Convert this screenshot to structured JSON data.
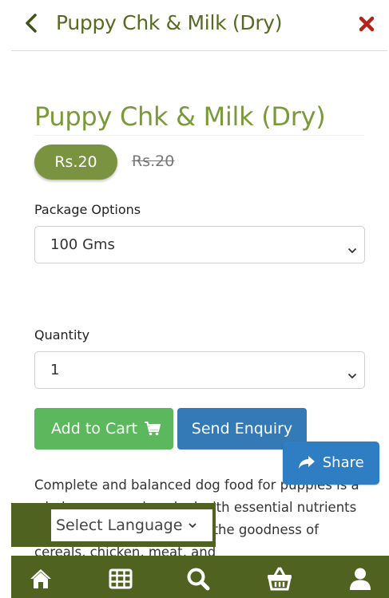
{
  "header": {
    "title": "Puppy Chk & Milk (Dry)"
  },
  "product": {
    "title": "Puppy Chk & Milk (Dry)",
    "price": "Rs.20",
    "old_price": "Rs.20",
    "package_label": "Package Options",
    "package_value": "100 Gms",
    "quantity_label": "Quantity",
    "quantity_value": "1",
    "description": "Complete and balanced dog food for puppies is a wholesome meal packed with essential nutrients of your pet. Pedigree, with the goodness of cereals, chicken, meat, and"
  },
  "actions": {
    "add_to_cart": "Add to Cart",
    "send_enquiry": "Send Enquiry",
    "share": "Share"
  },
  "language": {
    "selected": "Select Language"
  },
  "colors": {
    "brand_olive": "#4f6220",
    "title_green": "#7a9a3a",
    "cart_green": "#5cb85c",
    "enquiry_blue": "#337ab7",
    "close_red": "#b5221e"
  },
  "bottom_nav": [
    "home-icon",
    "grid-icon",
    "search-icon",
    "basket-icon",
    "user-icon"
  ]
}
